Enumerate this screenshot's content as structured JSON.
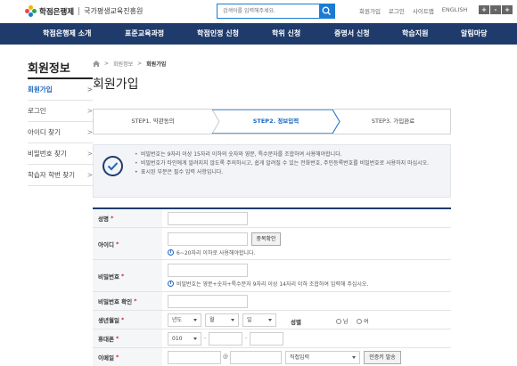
{
  "header": {
    "brand": "학점은행제",
    "org": "국가평생교육진흥원",
    "search_placeholder": "검색어를 입력해주세요.",
    "util_links": [
      "회원가입",
      "로그인",
      "사이트맵",
      "ENGLISH"
    ],
    "font_controls": [
      "+",
      "-",
      "+"
    ],
    "logo_colors": [
      "#e94b3c",
      "#f5b400",
      "#2aa84a",
      "#1b7bd4"
    ]
  },
  "nav": {
    "items": [
      "학점은행제 소개",
      "표준교육과정",
      "학점인정 신청",
      "학위 신청",
      "증명서 신청",
      "학습지원",
      "알림마당"
    ]
  },
  "sidebar": {
    "title": "회원정보",
    "items": [
      {
        "label": "회원가입",
        "chevron": ">"
      },
      {
        "label": "로그인",
        "chevron": ">"
      },
      {
        "label": "아이디 찾기",
        "chevron": ">"
      },
      {
        "label": "비밀번호 찾기",
        "chevron": ">"
      },
      {
        "label": "학습자 학번 찾기",
        "chevron": ">"
      }
    ]
  },
  "breadcrumb": {
    "items": [
      "회원정보",
      "회원가입"
    ],
    "sep": ">"
  },
  "page": {
    "title": "회원가입"
  },
  "steps": [
    {
      "label": "STEP1. 약관동의"
    },
    {
      "label": "STEP2. 정보입력"
    },
    {
      "label": "STEP3. 가입완료"
    }
  ],
  "notice": {
    "items": [
      "비밀번호는 9자리 이상 15자리 이하의 숫자와 영문, 특수문자를 조합하여 사용해야합니다.",
      "비밀번호가 타인에게 알려지지 않도록 주의하시고, 쉽게 알려질 수 있는 전화번호, 주민등록번호를 비밀번호로 사용하지 마십시오.",
      "표시된 부분은 필수 입력 사항입니다."
    ]
  },
  "form": {
    "required_mark": "*",
    "labels": {
      "name": "성명",
      "id": "아이디",
      "password": "비밀번호",
      "password_confirm": "비밀번호 확인",
      "birth": "생년월일",
      "gender": "성별",
      "mobile": "휴대폰",
      "email": "이메일"
    },
    "id_check_button": "중복확인",
    "id_hint": "6~20자리 이하로 사용해야합니다.",
    "password_hint": "비밀번호는 영문+숫자+특수문자 9자리 이상 14자리 이하 조합하여 입력해 주십시오.",
    "info_icon": "i",
    "birth_selects": [
      "년도",
      "월",
      "일"
    ],
    "gender_options": [
      "남",
      "여"
    ],
    "mobile_prefix": "010",
    "dash": "-",
    "email_at": "@",
    "email_domain_select": "직접입력",
    "email_auth_button": "인증키 발송"
  }
}
